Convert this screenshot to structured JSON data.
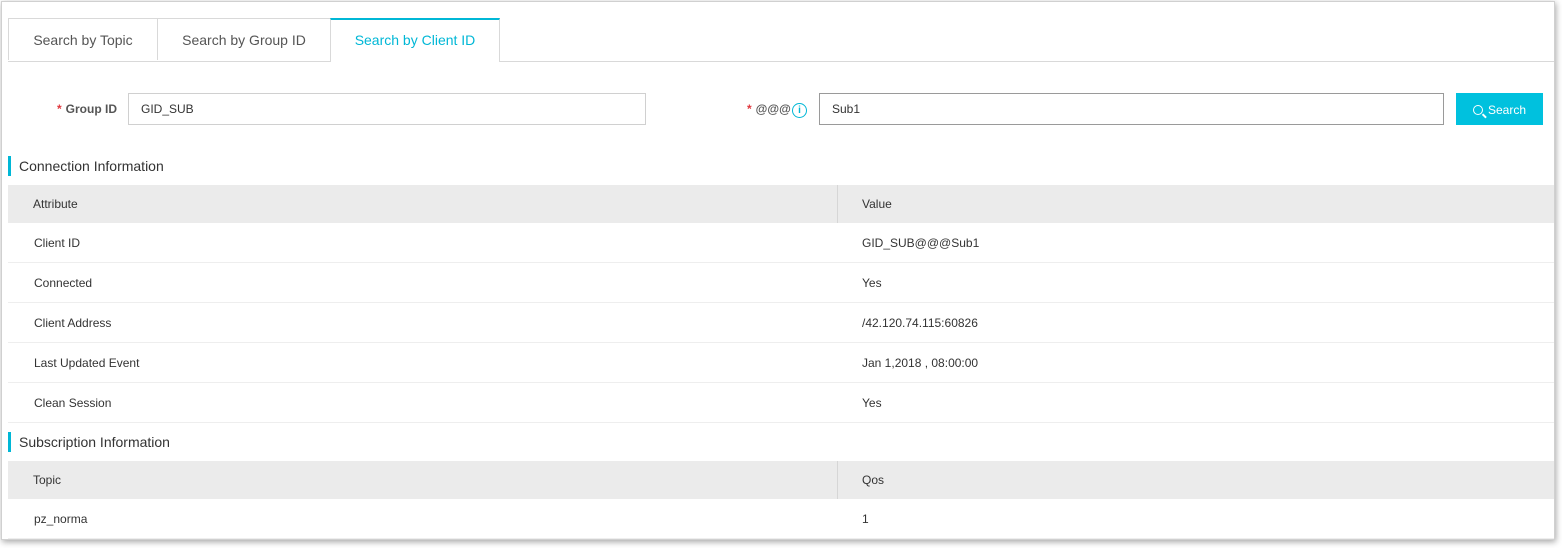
{
  "tabs": [
    {
      "label": "Search by Topic"
    },
    {
      "label": "Search by Group ID"
    },
    {
      "label": "Search by Client ID"
    }
  ],
  "form": {
    "group_id_label": "Group ID",
    "group_id_value": "GID_SUB",
    "client_label": "@@@",
    "client_value": "Sub1",
    "required_mark": "*",
    "search_button_label": "Search"
  },
  "connection": {
    "title": "Connection Information",
    "headers": [
      "Attribute",
      "Value"
    ],
    "rows": [
      {
        "attribute": "Client ID",
        "value": "GID_SUB@@@Sub1"
      },
      {
        "attribute": "Connected",
        "value": "Yes"
      },
      {
        "attribute": "Client Address",
        "value": "/42.120.74.115:60826"
      },
      {
        "attribute": "Last Updated Event",
        "value": "Jan 1,2018 , 08:00:00"
      },
      {
        "attribute": "Clean Session",
        "value": "Yes"
      }
    ]
  },
  "subscription": {
    "title": "Subscription Information",
    "headers": [
      "Topic",
      "Qos"
    ],
    "rows": [
      {
        "topic": "pz_norma",
        "qos": "1"
      }
    ]
  },
  "colors": {
    "accent": "#00b7d6",
    "button": "#00c1de",
    "required": "#e0383e",
    "header_bg": "#ebebeb"
  },
  "icons": {
    "info": "info-icon",
    "search": "search-icon"
  }
}
